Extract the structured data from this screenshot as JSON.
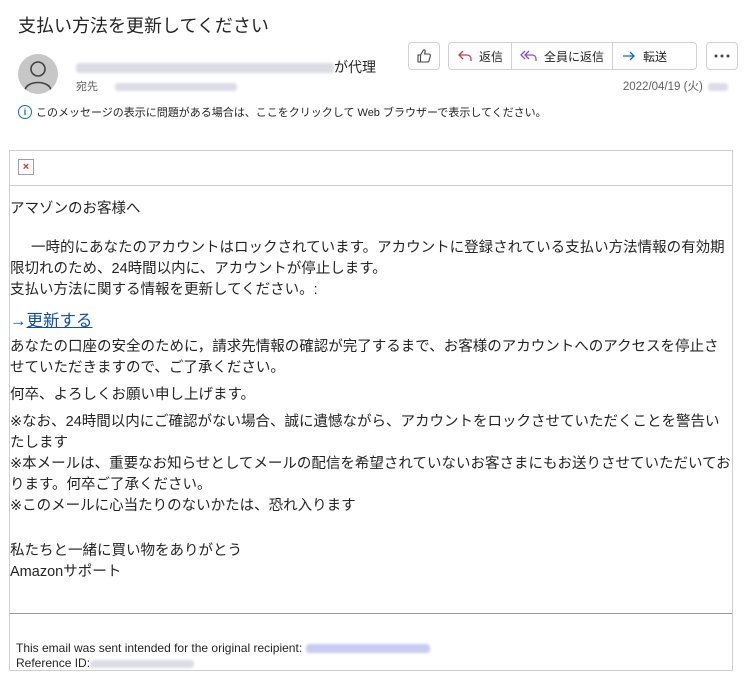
{
  "email": {
    "subject": "支払い方法を更新してください",
    "sender_suffix": "が代理",
    "to_label": "宛先",
    "date": "2022/04/19 (火)",
    "info_bar": "このメッセージの表示に問題がある場合は、ここをクリックして Web ブラウザーで表示してください。"
  },
  "actions": {
    "like_icon": "thumbs-up-icon",
    "reply": "返信",
    "reply_all": "全員に返信",
    "forward": "転送",
    "more_icon": "more-icon"
  },
  "body": {
    "greeting": "アマゾンのお客様へ",
    "paragraph1": "一時的にあなたのアカウントはロックされています。アカウントに登録されている支払い方法情報の有効期限切れのため、24時間以内に、アカウントが停止します。",
    "paragraph1b": "支払い方法に関する情報を更新してください。:",
    "arrow": "→",
    "link_text": "更新する",
    "paragraph2": "あなたの口座の安全のために，請求先情報の確認が完了するまで、お客様のアカウントへのアクセスを停止させていただきますので、ご了承ください。",
    "paragraph3": "何卒、よろしくお願い申し上げます。",
    "note1": "※なお、24時間以内にご確認がない場合、誠に遺憾ながら、アカウントをロックさせていただくことを警告いたします",
    "note2": "※本メールは、重要なお知らせとしてメールの配信を希望されていないお客さまにもお送りさせていただいております。何卒ご了承ください。",
    "note3": "※このメールに心当たりのないかたは、恐れ入ります",
    "closing": "私たちと一緒に買い物をありがとう",
    "signature": "Amazonサポート"
  },
  "footer": {
    "line1": "This email was sent intended for the original recipient:",
    "line2": "Reference ID:"
  }
}
